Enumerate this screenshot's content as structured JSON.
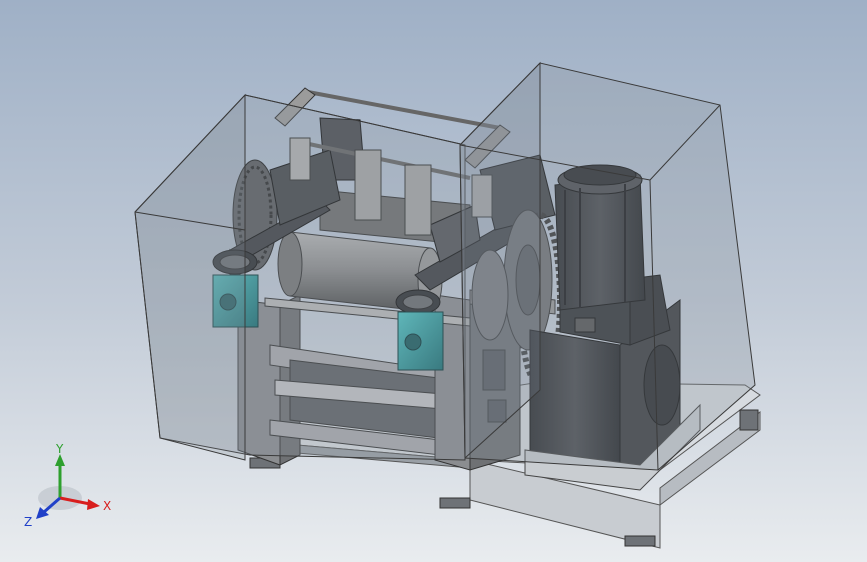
{
  "viewport": {
    "background_top": "#9fb0c6",
    "background_bottom": "#e9ecef"
  },
  "model": {
    "enclosure_color": "#9aa3ad",
    "frame_color": "#7d7f82",
    "roll_color": "#8c8c8c",
    "motor_color": "#3a3c3f",
    "gearbox_accent_color": "#27a1a5"
  },
  "triad": {
    "x_label": "X",
    "y_label": "Y",
    "z_label": "Z",
    "x_color": "#d81e1e",
    "y_color": "#2ea02e",
    "z_color": "#2040c8"
  }
}
